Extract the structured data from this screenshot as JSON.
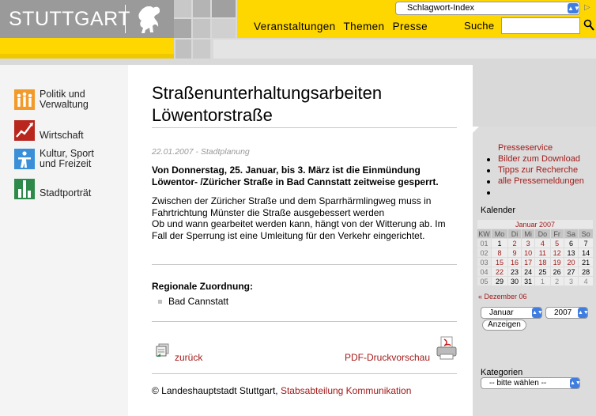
{
  "header": {
    "logo_text": "STUTTGART",
    "index_select": "Schlagwort-Index",
    "nav": [
      "Veranstaltungen",
      "Themen",
      "Presse"
    ],
    "search_label": "Suche",
    "search_value": ""
  },
  "sidebar": {
    "items": [
      {
        "label": "Politik und Verwaltung",
        "icon": "people-icon"
      },
      {
        "label": "Wirtschaft",
        "icon": "chart-icon"
      },
      {
        "label": "Kultur, Sport und Freizeit",
        "icon": "person-icon"
      },
      {
        "label": "Stadtporträt",
        "icon": "city-icon"
      }
    ]
  },
  "article": {
    "title": "Straßenunterhaltungsarbeiten Löwentorstraße",
    "meta": "22.01.2007 - Stadtplanung",
    "lead": "Von Donnerstag, 25. Januar, bis 3. März ist die Einmündung Löwentor- /Züricher Straße in Bad Cannstatt zeitweise gesperrt.",
    "body": "Zwischen der Züricher Straße und dem Sparrhärmlingweg muss in Fahrtrichtung Münster die Straße ausgebessert werden\nOb und wann gearbeitet werden kann, hängt von der Witterung ab. Im Fall der Sperrung ist eine Umleitung für den Verkehr eingerichtet.",
    "regional_title": "Regionale Zuordnung:",
    "regional_item": "Bad Cannstatt",
    "back_link": "zurück",
    "pdf_link": "PDF-Druckvorschau",
    "footer_prefix": "© Landeshauptstadt Stuttgart, ",
    "footer_link": "Stabsabteilung Kommunikation"
  },
  "rightbar": {
    "press_title": "Presseservice",
    "press_links": [
      "Bilder zum Download",
      "Tipps zur Recherche",
      "alle Pressemeldungen"
    ],
    "calendar_title": "Kalender",
    "calendar_month": "Januar 2007",
    "weekdays": [
      "KW",
      "Mo",
      "Di",
      "Mi",
      "Do",
      "Fr",
      "Sa",
      "So"
    ],
    "weeks": [
      {
        "kw": "01",
        "days": [
          "1",
          "2",
          "3",
          "4",
          "5",
          "6",
          "7"
        ]
      },
      {
        "kw": "02",
        "days": [
          "8",
          "9",
          "10",
          "11",
          "12",
          "13",
          "14"
        ]
      },
      {
        "kw": "03",
        "days": [
          "15",
          "16",
          "17",
          "18",
          "19",
          "20",
          "21"
        ]
      },
      {
        "kw": "04",
        "days": [
          "22",
          "23",
          "24",
          "25",
          "26",
          "27",
          "28"
        ]
      },
      {
        "kw": "05",
        "days": [
          "29",
          "30",
          "31",
          "1",
          "2",
          "3",
          "4"
        ]
      }
    ],
    "prev_month": "« Dezember 06",
    "month_select": "Januar",
    "year_select": "2007",
    "show_button": "Anzeigen",
    "categories_title": "Kategorien",
    "categories_select": "-- bitte wählen --"
  },
  "colors": {
    "yellow": "#ffd700",
    "gray": "#9a9a9a",
    "link_red": "#a31a1a"
  }
}
